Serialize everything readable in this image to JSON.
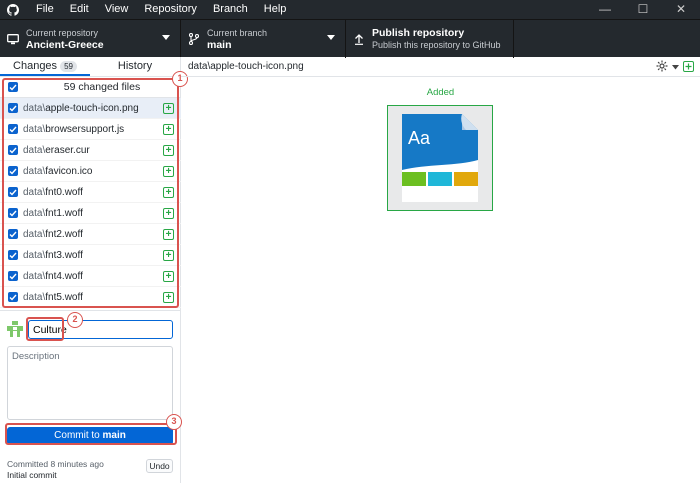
{
  "menu": [
    "File",
    "Edit",
    "View",
    "Repository",
    "Branch",
    "Help"
  ],
  "window_controls": {
    "minimize": "—",
    "maximize": "☐",
    "close": "✕"
  },
  "toolbar": {
    "repo_label": "Current repository",
    "repo_value": "Ancient-Greece",
    "branch_label": "Current branch",
    "branch_value": "main",
    "publish_title": "Publish repository",
    "publish_sub": "Publish this repository to GitHub"
  },
  "tabs": {
    "changes": "Changes",
    "changes_count": "59",
    "history": "History"
  },
  "changes": {
    "all_label": "59 changed files",
    "files": [
      {
        "dir": "data\\",
        "name": "apple-touch-icon.png"
      },
      {
        "dir": "data\\",
        "name": "browsersupport.js"
      },
      {
        "dir": "data\\",
        "name": "eraser.cur"
      },
      {
        "dir": "data\\",
        "name": "favicon.ico"
      },
      {
        "dir": "data\\",
        "name": "fnt0.woff"
      },
      {
        "dir": "data\\",
        "name": "fnt1.woff"
      },
      {
        "dir": "data\\",
        "name": "fnt2.woff"
      },
      {
        "dir": "data\\",
        "name": "fnt3.woff"
      },
      {
        "dir": "data\\",
        "name": "fnt4.woff"
      },
      {
        "dir": "data\\",
        "name": "fnt5.woff"
      }
    ]
  },
  "commit": {
    "summary_value": "Culture",
    "description_placeholder": "Description",
    "button_prefix": "Commit to ",
    "button_branch": "main",
    "last_commit_time": "Committed 8 minutes ago",
    "last_commit_summary": "Initial commit",
    "undo_label": "Undo"
  },
  "diff": {
    "path": "data\\apple-touch-icon.png",
    "status": "Added",
    "preview_text": "Aa"
  },
  "annotations": [
    "1",
    "2",
    "3"
  ],
  "colors": {
    "accent": "#0366d6",
    "added": "#28a745",
    "highlight": "#d9534f",
    "toolbar_bg": "#24292e"
  }
}
